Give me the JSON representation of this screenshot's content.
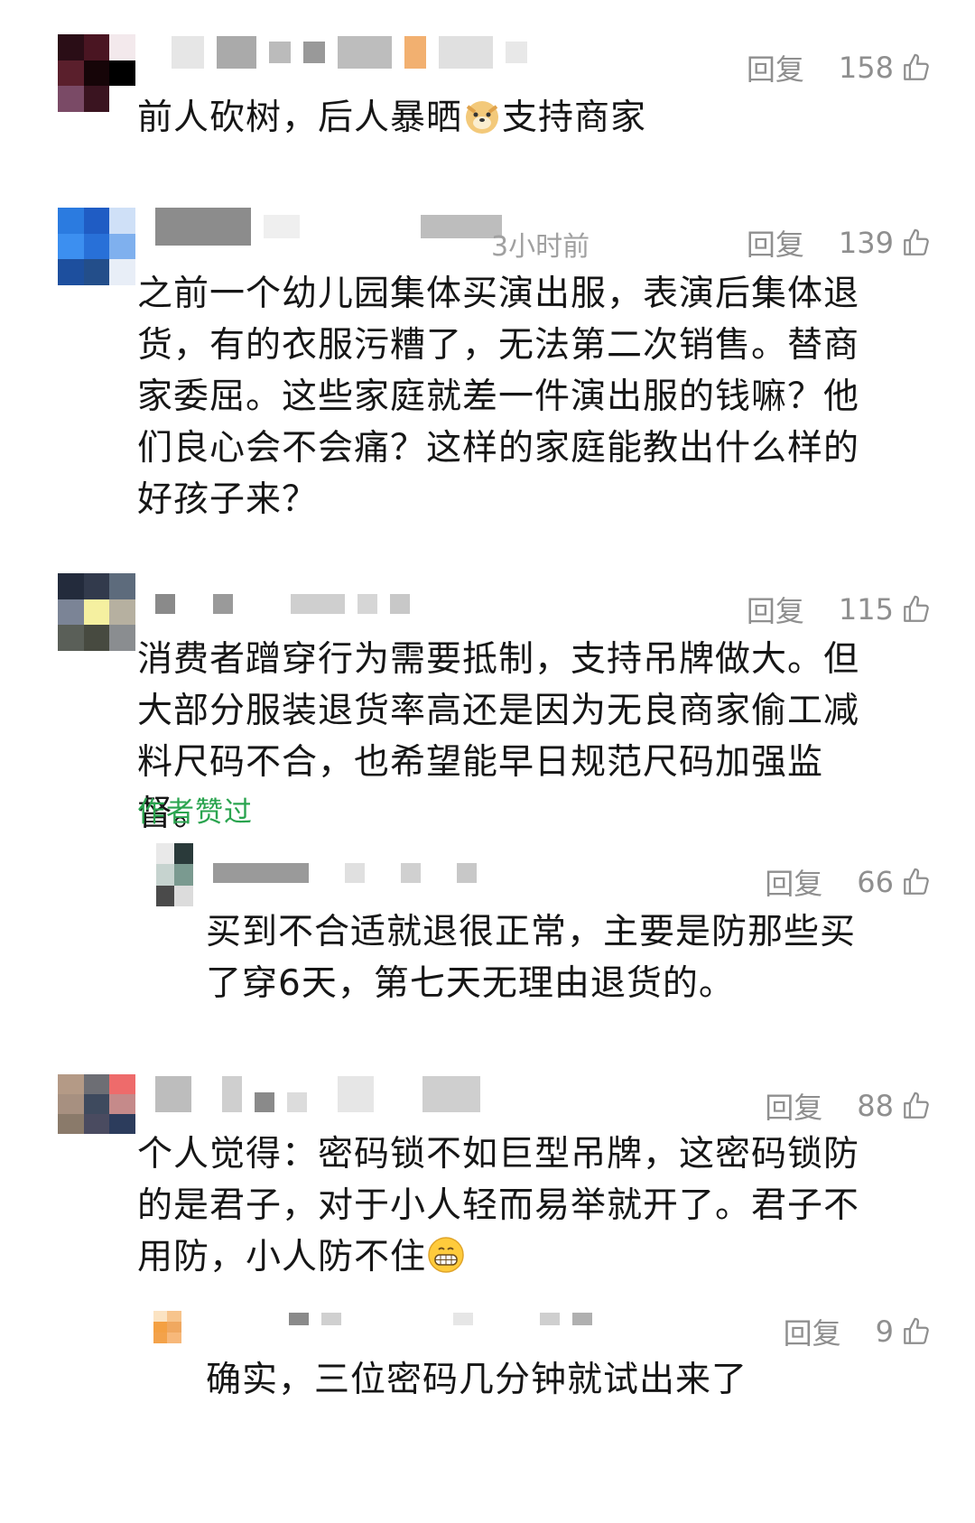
{
  "comments": [
    {
      "id": "c1",
      "reply_label": "回复",
      "likes": "158",
      "text": "前人砍树，后人暴晒",
      "emoji": "doge-emoji",
      "text_after": "支持商家"
    },
    {
      "id": "c2",
      "timestamp": "3小时前",
      "reply_label": "回复",
      "likes": "139",
      "text": "之前一个幼儿园集体买演出服，表演后集体退货，有的衣服污糟了，无法第二次销售。替商家委屈。这些家庭就差一件演出服的钱嘛？他们良心会不会痛？这样的家庭能教出什么样的好孩子来？"
    },
    {
      "id": "c3",
      "reply_label": "回复",
      "likes": "115",
      "text": "消费者蹭穿行为需要抵制，支持吊牌做大。但大部分服装退货率高还是因为无良商家偷工减料尺码不合，也希望能早日规范尺码加强监督。",
      "author_liked": "作者赞过"
    },
    {
      "id": "c3-reply",
      "reply_label": "回复",
      "likes": "66",
      "text": "买到不合适就退很正常，主要是防那些买了穿6天，第七天无理由退货的。"
    },
    {
      "id": "c4",
      "reply_label": "回复",
      "likes": "88",
      "text": "个人觉得：密码锁不如巨型吊牌，这密码锁防的是君子，对于小人轻而易举就开了。君子不用防，小人防不住",
      "emoji": "grin-emoji"
    },
    {
      "id": "c4-reply",
      "reply_label": "回复",
      "likes": "9",
      "text": "确实，三位密码几分钟就试出来了"
    }
  ],
  "icons": {
    "like": "thumbs-up-icon"
  },
  "colors": {
    "author_liked": "#2aa44f",
    "meta": "#8f8f8f"
  }
}
